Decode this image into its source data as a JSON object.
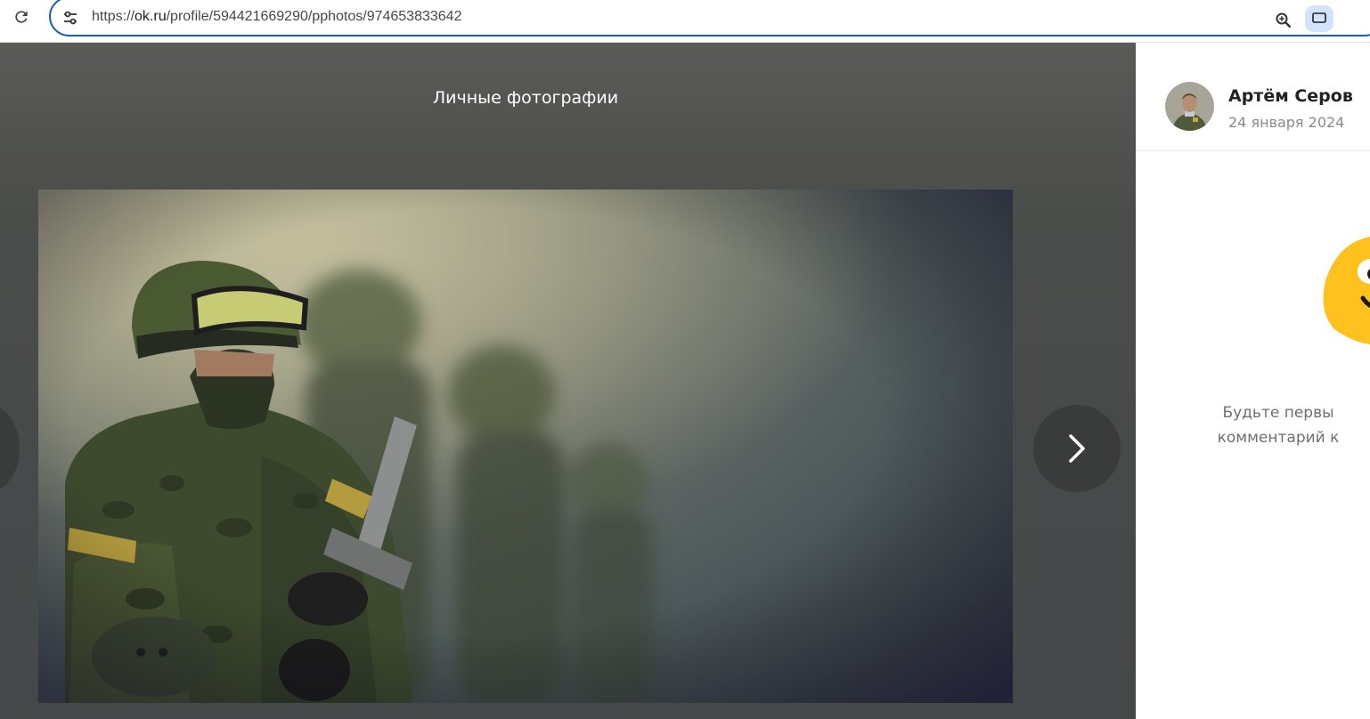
{
  "browser": {
    "url_prefix": "https://",
    "url_host": "ok.ru",
    "url_path": "/profile/594421669290/pphotos/974653833642",
    "icons": {
      "reload": "reload-icon",
      "site_info": "tune-icon",
      "zoom": "zoom-in-icon",
      "extension": "cast-icon"
    }
  },
  "viewer": {
    "album_title": "Личные фотографии",
    "photo_icon": "soldier-photo",
    "next_icon": "chevron-right-icon"
  },
  "side_panel": {
    "author_name": "Артём Серов",
    "post_date": "24 января 2024",
    "empty_line1": "Будьте первы",
    "empty_line2": "комментарий к"
  },
  "colors": {
    "accent": "#1a5fb4",
    "sticker": "#ffc11e"
  }
}
